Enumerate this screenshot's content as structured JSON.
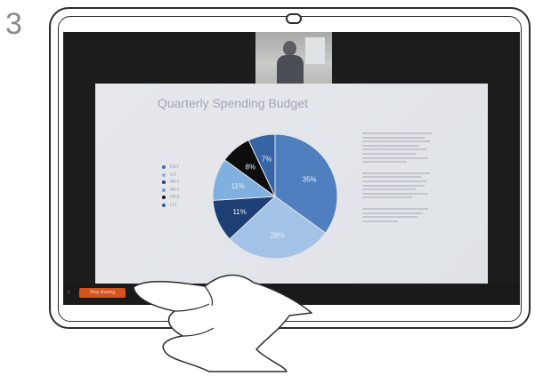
{
  "step": {
    "number": "3"
  },
  "slide": {
    "title": "Quarterly Spending Budget",
    "legend": [
      {
        "label": "DEV",
        "color": "#3f6fa8"
      },
      {
        "label": "UX",
        "color": "#8fb0d6"
      },
      {
        "label": "MKT",
        "color": "#1f3f72"
      },
      {
        "label": "MKT",
        "color": "#6d9ad0"
      },
      {
        "label": "OPS",
        "color": "#111111"
      },
      {
        "label": "LTL",
        "color": "#2b5c9a"
      }
    ]
  },
  "chart_data": {
    "type": "pie",
    "title": "Quarterly Spending Budget",
    "slices": [
      {
        "label": "35%",
        "value": 35,
        "color": "#4f7fbf"
      },
      {
        "label": "28%",
        "value": 28,
        "color": "#a3c3e6"
      },
      {
        "label": "11%",
        "value": 11,
        "color": "#1d3f73"
      },
      {
        "label": "11%",
        "value": 11,
        "color": "#7fb0e0"
      },
      {
        "label": "8%",
        "value": 8,
        "color": "#0d0d0d"
      },
      {
        "label": "7%",
        "value": 7,
        "color": "#3565a5"
      }
    ]
  },
  "controls": {
    "stop_label": "Stop sharing",
    "menu_icon": "chevron-left-icon"
  }
}
